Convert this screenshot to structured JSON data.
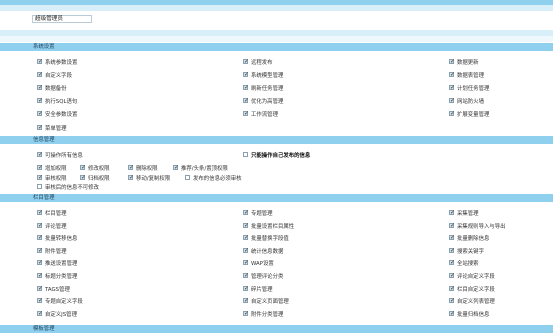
{
  "header": {
    "role_name": "超级管理员"
  },
  "sections": [
    {
      "title": "系统设置",
      "items": [
        {
          "label": "系统参数设置",
          "checked": true
        },
        {
          "label": "远程发布",
          "checked": true
        },
        {
          "label": "数据更新",
          "checked": true
        },
        {
          "label": "自定义字段",
          "checked": true
        },
        {
          "label": "系统模型管理",
          "checked": true
        },
        {
          "label": "数据表管理",
          "checked": true
        },
        {
          "label": "数据备份",
          "checked": true
        },
        {
          "label": "刷新任务管理",
          "checked": true
        },
        {
          "label": "计划任务管理",
          "checked": true
        },
        {
          "label": "执行SQL语句",
          "checked": true
        },
        {
          "label": "优化为高管理",
          "checked": true
        },
        {
          "label": "网站防火墙",
          "checked": true
        },
        {
          "label": "安全参数设置",
          "checked": true
        },
        {
          "label": "工作流管理",
          "checked": true
        },
        {
          "label": "扩展变量管理",
          "checked": true
        },
        {
          "label": "菜单管理",
          "checked": true
        }
      ]
    },
    {
      "title": "信息管理",
      "rows": [
        [
          {
            "label": "可操作所有信息",
            "checked": true,
            "bold": false
          },
          {
            "label": "只能操作自己发布的信息",
            "checked": false,
            "bold": true
          }
        ],
        [
          {
            "label": "增加权限",
            "checked": true
          },
          {
            "label": "修改权限",
            "checked": true
          },
          {
            "label": "删除权限",
            "checked": true
          },
          {
            "label": "推荐/头条/置顶权限",
            "checked": true
          }
        ],
        [
          {
            "label": "审核权限",
            "checked": true
          },
          {
            "label": "归档权限",
            "checked": true
          },
          {
            "label": "移动/复制权限",
            "checked": true
          },
          {
            "label": "发布的信息必须审核",
            "checked": false
          }
        ],
        [
          {
            "label": "审核后的信息不可修改",
            "checked": false
          }
        ]
      ]
    },
    {
      "title": "栏目管理",
      "items": [
        {
          "label": "栏目管理",
          "checked": true
        },
        {
          "label": "专题管理",
          "checked": true
        },
        {
          "label": "采集管理",
          "checked": true
        },
        {
          "label": "评论管理",
          "checked": true
        },
        {
          "label": "批量设置栏目属性",
          "checked": true
        },
        {
          "label": "采集规则导入与导出",
          "checked": true
        },
        {
          "label": "批量转移信息",
          "checked": true
        },
        {
          "label": "批量替换字段值",
          "checked": true
        },
        {
          "label": "批量删除信息",
          "checked": true
        },
        {
          "label": "附件管理",
          "checked": true
        },
        {
          "label": "统计信息数据",
          "checked": true
        },
        {
          "label": "搜索关键字",
          "checked": true
        },
        {
          "label": "推送设置管理",
          "checked": true
        },
        {
          "label": "WAP设置",
          "checked": true
        },
        {
          "label": "全站搜索",
          "checked": true
        },
        {
          "label": "标题分类管理",
          "checked": true
        },
        {
          "label": "管理评论分类",
          "checked": true
        },
        {
          "label": "评论自定义字段",
          "checked": true
        },
        {
          "label": "TAGS管理",
          "checked": true
        },
        {
          "label": "碎片管理",
          "checked": true
        },
        {
          "label": "栏目自定义字段",
          "checked": true
        },
        {
          "label": "专题自定义字段",
          "checked": true
        },
        {
          "label": "自定义页面管理",
          "checked": true
        },
        {
          "label": "自定义列表管理",
          "checked": true
        },
        {
          "label": "自定义JS管理",
          "checked": true
        },
        {
          "label": "附件分类管理",
          "checked": true
        },
        {
          "label": "批量归档信息",
          "checked": true
        }
      ]
    },
    {
      "title": "模板管理"
    }
  ]
}
